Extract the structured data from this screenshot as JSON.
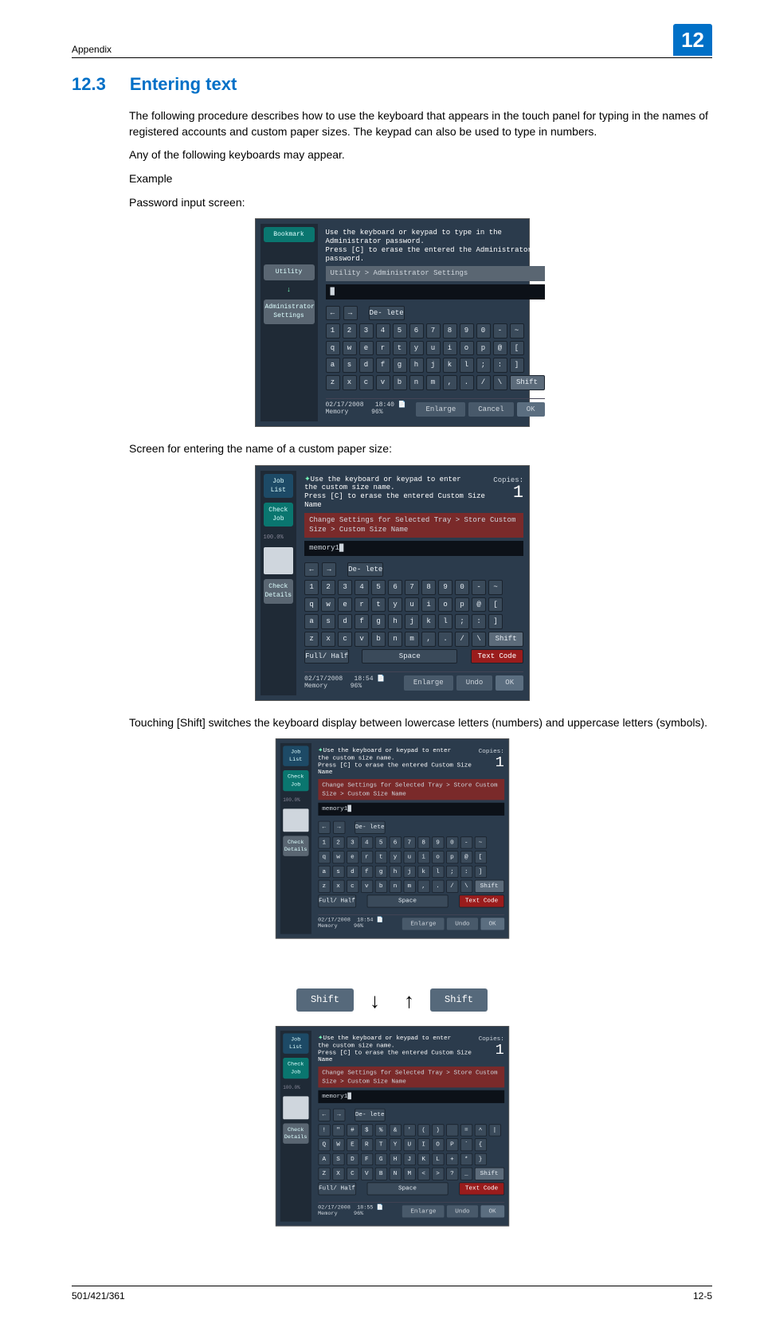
{
  "header": {
    "appendix": "Appendix",
    "chapter": "12"
  },
  "section": {
    "number": "12.3",
    "title": "Entering text"
  },
  "paras": {
    "intro": "The following procedure describes how to use the keyboard that appears in the touch panel for typing in the names of registered accounts and custom paper sizes. The keypad can also be used to type in numbers.",
    "anyof": "Any of the following keyboards may appear.",
    "example": "Example",
    "pw": "Password input screen:",
    "custom": "Screen for entering the name of a custom paper size:",
    "shiftnote": "Touching [Shift] switches the keyboard display between lowercase letters (numbers) and uppercase letters (symbols)."
  },
  "shot1": {
    "instr1": "Use the keyboard or keypad to type in the Administrator password.",
    "instr2": "Press [C] to erase the entered the Administrator password.",
    "crumb": "Utility > Administrator Settings",
    "side": {
      "bookmark": "Bookmark",
      "utility": "Utility",
      "admin": "Administrator Settings"
    },
    "btns": {
      "delete": "De-\nlete",
      "shift": "Shift",
      "cancel": "Cancel",
      "ok": "OK",
      "enlarge": "Enlarge"
    },
    "bottom": {
      "date": "02/17/2008",
      "time": "18:40",
      "memlabel": "Memory",
      "mem": "96%"
    },
    "rows": {
      "r1": [
        "1",
        "2",
        "3",
        "4",
        "5",
        "6",
        "7",
        "8",
        "9",
        "0",
        "-",
        "~"
      ],
      "r2": [
        "q",
        "w",
        "e",
        "r",
        "t",
        "y",
        "u",
        "i",
        "o",
        "p",
        "@",
        "["
      ],
      "r3": [
        "a",
        "s",
        "d",
        "f",
        "g",
        "h",
        "j",
        "k",
        "l",
        ";",
        ":",
        "]"
      ],
      "r4": [
        "z",
        "x",
        "c",
        "v",
        "b",
        "n",
        "m",
        ",",
        ".",
        "/",
        "\\"
      ]
    }
  },
  "shot2": {
    "side": {
      "joblist": "Job List",
      "checkjob": "Check Job",
      "details": "Check Details",
      "pct": "100.0%"
    },
    "instr1": "Use the keyboard or keypad to enter",
    "instr2": "the custom size name.",
    "instr3": "Press [C] to erase the entered Custom Size Name",
    "copies": "Copies:",
    "copiesnum": "1",
    "crumb": "Change Settings for Selected Tray > Store Custom Size > Custom Size Name",
    "val": "memory1",
    "btns": {
      "delete": "De-\nlete",
      "shift": "Shift",
      "fh": "Full/\nHalf",
      "space": "Space",
      "text": "Text Code",
      "undo": "Undo",
      "ok": "OK",
      "enlarge": "Enlarge"
    },
    "bottom": {
      "date": "02/17/2008",
      "time": "18:54",
      "memlabel": "Memory",
      "mem": "96%"
    }
  },
  "shot3": {
    "bottom": {
      "time": "18:54"
    },
    "rows": {
      "r1": [
        "1",
        "2",
        "3",
        "4",
        "5",
        "6",
        "7",
        "8",
        "9",
        "0",
        "-",
        "~"
      ],
      "r2": [
        "q",
        "w",
        "e",
        "r",
        "t",
        "y",
        "u",
        "i",
        "o",
        "p",
        "@",
        "["
      ],
      "r3": [
        "a",
        "s",
        "d",
        "f",
        "g",
        "h",
        "j",
        "k",
        "l",
        ";",
        ":",
        "]"
      ],
      "r4": [
        "z",
        "x",
        "c",
        "v",
        "b",
        "n",
        "m",
        ",",
        ".",
        "/",
        "\\"
      ]
    }
  },
  "shiftbtn": "Shift",
  "shot4": {
    "bottom": {
      "time": "18:55"
    },
    "rows": {
      "r1": [
        "!",
        "\"",
        "#",
        "$",
        "%",
        "&",
        "'",
        "(",
        ")",
        " ",
        "=",
        "^",
        "|"
      ],
      "r2": [
        "Q",
        "W",
        "E",
        "R",
        "T",
        "Y",
        "U",
        "I",
        "O",
        "P",
        "`",
        "{"
      ],
      "r3": [
        "A",
        "S",
        "D",
        "F",
        "G",
        "H",
        "J",
        "K",
        "L",
        "+",
        "*",
        "}"
      ],
      "r4": [
        "Z",
        "X",
        "C",
        "V",
        "B",
        "N",
        "M",
        "<",
        ">",
        "?",
        "_"
      ]
    }
  },
  "footer": {
    "left": "501/421/361",
    "right": "12-5"
  }
}
